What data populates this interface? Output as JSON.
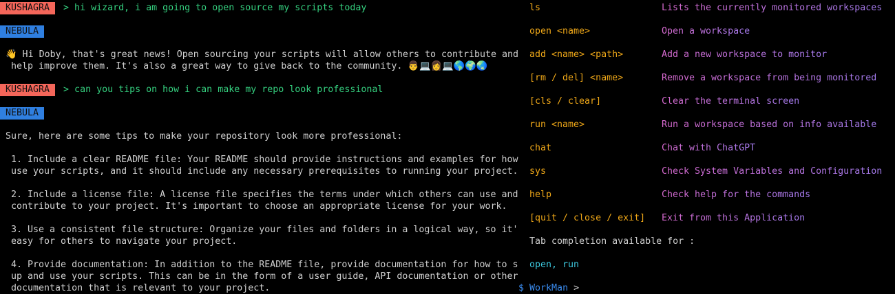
{
  "colors": {
    "user_badge": "#f4665a",
    "bot_badge": "#2f7fe0",
    "user_text": "#35d07f",
    "command": "#f0a818",
    "description": "#b870e0",
    "tab_completion": "#3cc6dc",
    "prompt": "#3a8cf0"
  },
  "chat": [
    {
      "type": "user",
      "name": "KUSHAGRA",
      "text": "> hi wizard, i am going to open source my scripts today"
    },
    {
      "type": "bot",
      "name": "NEBULA"
    },
    {
      "type": "text",
      "text": "👋 Hi Doby, that's great news! Open sourcing your scripts will allow others to contribute and"
    },
    {
      "type": "text",
      "text": " help improve them. It's also a great way to give back to the community. 👨💻👩💻🌎🌍🌏"
    },
    {
      "type": "user",
      "name": "KUSHAGRA",
      "text": "> can you tips on how i can make my repo look professional"
    },
    {
      "type": "bot",
      "name": "NEBULA"
    },
    {
      "type": "text",
      "text": "Sure, here are some tips to make your repository look more professional:"
    },
    {
      "type": "text",
      "text": " 1. Include a clear README file: Your README should provide instructions and examples for how"
    },
    {
      "type": "text",
      "text": " use your scripts, and it should include any necessary prerequisites to running your project."
    },
    {
      "type": "text",
      "text": " 2. Include a license file: A license file specifies the terms under which others can use and"
    },
    {
      "type": "text",
      "text": " contribute to your project. It's important to choose an appropriate license for your work."
    },
    {
      "type": "text",
      "text": " 3. Use a consistent file structure: Organize your files and folders in a logical way, so it'"
    },
    {
      "type": "text",
      "text": " easy for others to navigate your project."
    },
    {
      "type": "text",
      "text": " 4. Provide documentation: In addition to the README file, provide documentation for how to s"
    },
    {
      "type": "text",
      "text": " up and use your scripts. This can be in the form of a user guide, API documentation or other"
    },
    {
      "type": "text",
      "text": " documentation that is relevant to your project."
    }
  ],
  "help": [
    {
      "cmd": "ls",
      "desc": "Lists the currently monitored workspaces"
    },
    {
      "cmd": "open <name>",
      "desc": "Open a workspace"
    },
    {
      "cmd": "add <name> <path>",
      "desc": "Add a new workspace to monitor"
    },
    {
      "cmd": "[rm / del] <name>",
      "desc": "Remove a workspace from being monitored"
    },
    {
      "cmd": "[cls / clear]",
      "desc": "Clear the terminal screen"
    },
    {
      "cmd": "run <name>",
      "desc": "Run a workspace based on info available"
    },
    {
      "cmd": "chat",
      "desc": "Chat with ChatGPT"
    },
    {
      "cmd": "sys",
      "desc": "Check System Variables and Configuration"
    },
    {
      "cmd": "help",
      "desc": "Check help for the commands"
    },
    {
      "cmd": "[quit / close / exit]",
      "desc": "Exit from this Application"
    }
  ],
  "tab_completion_label": "Tab completion available for :",
  "tab_completion_values": "open, run",
  "prompt": {
    "symbol": "$",
    "name": "WorkMan",
    "arrow": ">"
  }
}
